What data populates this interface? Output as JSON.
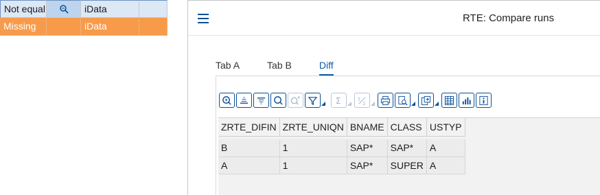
{
  "legend": {
    "rows": [
      {
        "status": "Not equal",
        "icon": "zoom-icon",
        "system": "iData",
        "bg": "#dce8f6"
      },
      {
        "status": "Missing",
        "icon": "",
        "system": "iData",
        "bg": "#f79b4a"
      }
    ]
  },
  "window": {
    "title": "RTE: Compare runs",
    "tabs": [
      {
        "label": "Tab A",
        "active": false
      },
      {
        "label": "Tab B",
        "active": false
      },
      {
        "label": "Diff",
        "active": true
      }
    ]
  },
  "toolbar": {
    "buttons": [
      {
        "icon": "details-icon",
        "enabled": true
      },
      {
        "icon": "sort-ascending-icon",
        "enabled": true
      },
      {
        "icon": "sort-descending-icon",
        "enabled": true
      },
      {
        "icon": "find-icon",
        "enabled": true
      },
      {
        "icon": "find-next-icon",
        "enabled": false
      },
      {
        "icon": "filter-icon",
        "enabled": true
      },
      {
        "icon": "sum-icon",
        "enabled": false
      },
      {
        "icon": "subtotal-icon",
        "enabled": false
      },
      {
        "icon": "print-icon",
        "enabled": true
      },
      {
        "icon": "views-icon",
        "enabled": true
      },
      {
        "icon": "export-icon",
        "enabled": true
      },
      {
        "icon": "layout-icon",
        "enabled": true
      },
      {
        "icon": "graphic-icon",
        "enabled": true
      },
      {
        "icon": "info-icon",
        "enabled": true
      }
    ]
  },
  "grid": {
    "columns": [
      "ZRTE_DIFIN",
      "ZRTE_UNIQN",
      "BNAME",
      "CLASS",
      "USTYP"
    ],
    "rows": [
      [
        "B",
        "1",
        "SAP*",
        "SAP*",
        "A"
      ],
      [
        "A",
        "1",
        "SAP*",
        "SUPER",
        "A"
      ]
    ]
  },
  "colors": {
    "accent": "#0a5ca8",
    "not_equal_row": "#dce8f6",
    "missing_row": "#f79b4a"
  }
}
